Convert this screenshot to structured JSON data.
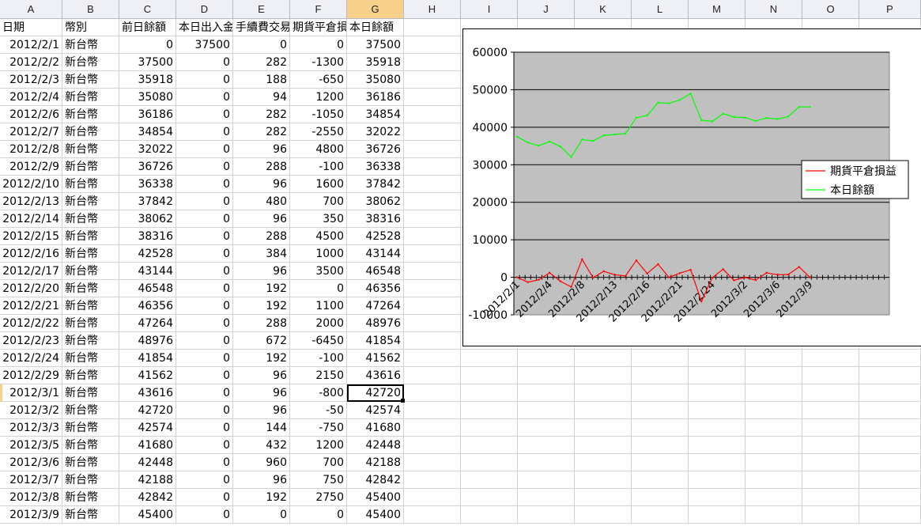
{
  "columns": [
    "A",
    "B",
    "C",
    "D",
    "E",
    "F",
    "G",
    "H",
    "I",
    "J",
    "K",
    "L",
    "M",
    "N",
    "O",
    "P"
  ],
  "selected_column": "G",
  "headers": [
    "日期",
    "幣別",
    "前日餘額",
    "本日出入金",
    "手續費交易稅",
    "期貨平倉損益",
    "本日餘額"
  ],
  "rows": [
    [
      "2012/2/1",
      "新台幣",
      "0",
      "37500",
      "0",
      "0",
      "37500"
    ],
    [
      "2012/2/2",
      "新台幣",
      "37500",
      "0",
      "282",
      "-1300",
      "35918"
    ],
    [
      "2012/2/3",
      "新台幣",
      "35918",
      "0",
      "188",
      "-650",
      "35080"
    ],
    [
      "2012/2/4",
      "新台幣",
      "35080",
      "0",
      "94",
      "1200",
      "36186"
    ],
    [
      "2012/2/6",
      "新台幣",
      "36186",
      "0",
      "282",
      "-1050",
      "34854"
    ],
    [
      "2012/2/7",
      "新台幣",
      "34854",
      "0",
      "282",
      "-2550",
      "32022"
    ],
    [
      "2012/2/8",
      "新台幣",
      "32022",
      "0",
      "96",
      "4800",
      "36726"
    ],
    [
      "2012/2/9",
      "新台幣",
      "36726",
      "0",
      "288",
      "-100",
      "36338"
    ],
    [
      "2012/2/10",
      "新台幣",
      "36338",
      "0",
      "96",
      "1600",
      "37842"
    ],
    [
      "2012/2/13",
      "新台幣",
      "37842",
      "0",
      "480",
      "700",
      "38062"
    ],
    [
      "2012/2/14",
      "新台幣",
      "38062",
      "0",
      "96",
      "350",
      "38316"
    ],
    [
      "2012/2/15",
      "新台幣",
      "38316",
      "0",
      "288",
      "4500",
      "42528"
    ],
    [
      "2012/2/16",
      "新台幣",
      "42528",
      "0",
      "384",
      "1000",
      "43144"
    ],
    [
      "2012/2/17",
      "新台幣",
      "43144",
      "0",
      "96",
      "3500",
      "46548"
    ],
    [
      "2012/2/20",
      "新台幣",
      "46548",
      "0",
      "192",
      "0",
      "46356"
    ],
    [
      "2012/2/21",
      "新台幣",
      "46356",
      "0",
      "192",
      "1100",
      "47264"
    ],
    [
      "2012/2/22",
      "新台幣",
      "47264",
      "0",
      "288",
      "2000",
      "48976"
    ],
    [
      "2012/2/23",
      "新台幣",
      "48976",
      "0",
      "672",
      "-6450",
      "41854"
    ],
    [
      "2012/2/24",
      "新台幣",
      "41854",
      "0",
      "192",
      "-100",
      "41562"
    ],
    [
      "2012/2/29",
      "新台幣",
      "41562",
      "0",
      "96",
      "2150",
      "43616"
    ],
    [
      "2012/3/1",
      "新台幣",
      "43616",
      "0",
      "96",
      "-800",
      "42720"
    ],
    [
      "2012/3/2",
      "新台幣",
      "42720",
      "0",
      "96",
      "-50",
      "42574"
    ],
    [
      "2012/3/3",
      "新台幣",
      "42574",
      "0",
      "144",
      "-750",
      "41680"
    ],
    [
      "2012/3/5",
      "新台幣",
      "41680",
      "0",
      "432",
      "1200",
      "42448"
    ],
    [
      "2012/3/6",
      "新台幣",
      "42448",
      "0",
      "960",
      "700",
      "42188"
    ],
    [
      "2012/3/7",
      "新台幣",
      "42188",
      "0",
      "96",
      "750",
      "42842"
    ],
    [
      "2012/3/8",
      "新台幣",
      "42842",
      "0",
      "192",
      "2750",
      "45400"
    ],
    [
      "2012/3/9",
      "新台幣",
      "45400",
      "0",
      "0",
      "0",
      "45400"
    ]
  ],
  "active_cell": {
    "row": 20,
    "col": 6
  },
  "colors": {
    "plot_area": "#c0c0c0",
    "series_pnl": "#ff0000",
    "series_balance": "#00ff00",
    "header_selected": "#f7d08a"
  },
  "chart_data": {
    "type": "line",
    "ylim": [
      -10000,
      60000
    ],
    "yticks": [
      -10000,
      0,
      10000,
      20000,
      30000,
      40000,
      50000,
      60000
    ],
    "ytick_labels": [
      "-10000",
      "0",
      "10000",
      "20000",
      "30000",
      "40000",
      "50000",
      "60000"
    ],
    "x": [
      "2012/2/1",
      "2012/2/2",
      "2012/2/3",
      "2012/2/4",
      "2012/2/6",
      "2012/2/7",
      "2012/2/8",
      "2012/2/9",
      "2012/2/10",
      "2012/2/13",
      "2012/2/14",
      "2012/2/15",
      "2012/2/16",
      "2012/2/17",
      "2012/2/20",
      "2012/2/21",
      "2012/2/22",
      "2012/2/23",
      "2012/2/24",
      "2012/2/29",
      "2012/3/1",
      "2012/3/2",
      "2012/3/3",
      "2012/3/5",
      "2012/3/6",
      "2012/3/7",
      "2012/3/8",
      "2012/3/9"
    ],
    "xtick_labels": [
      "2012/2/1",
      "2012/2/4",
      "2012/2/8",
      "2012/2/13",
      "2012/2/16",
      "2012/2/21",
      "2012/2/24",
      "2012/3/2",
      "2012/3/6",
      "2012/3/9"
    ],
    "series": [
      {
        "name": "期貨平倉損益",
        "color": "#ff0000",
        "values": [
          0,
          -1300,
          -650,
          1200,
          -1050,
          -2550,
          4800,
          -100,
          1600,
          700,
          350,
          4500,
          1000,
          3500,
          0,
          1100,
          2000,
          -6450,
          -100,
          2150,
          -800,
          -50,
          -750,
          1200,
          700,
          750,
          2750,
          0
        ]
      },
      {
        "name": "本日餘額",
        "color": "#00ff00",
        "values": [
          37500,
          35918,
          35080,
          36186,
          34854,
          32022,
          36726,
          36338,
          37842,
          38062,
          38316,
          42528,
          43144,
          46548,
          46356,
          47264,
          48976,
          41854,
          41562,
          43616,
          42720,
          42574,
          41680,
          42448,
          42188,
          42842,
          45400,
          45400
        ]
      }
    ],
    "legend_position": "right",
    "grid": true
  }
}
